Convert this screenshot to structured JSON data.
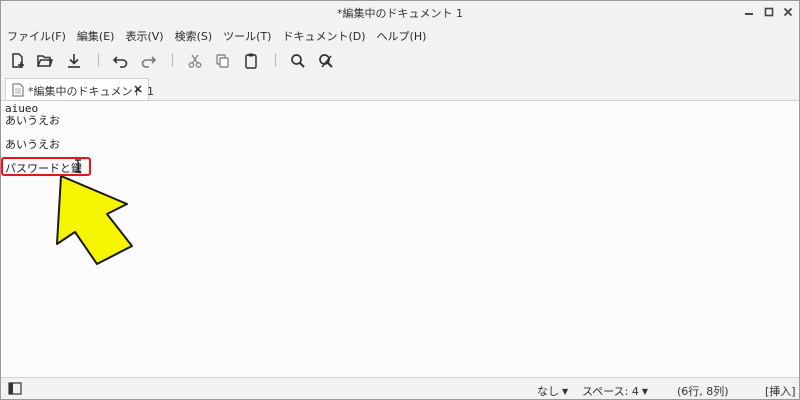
{
  "window": {
    "title": "*編集中のドキュメント 1"
  },
  "menu": {
    "items": [
      "ファイル(F)",
      "編集(E)",
      "表示(V)",
      "検索(S)",
      "ツール(T)",
      "ドキュメント(D)",
      "ヘルプ(H)"
    ]
  },
  "toolbar": {
    "icons": [
      "new-document-icon",
      "open-folder-icon",
      "save-download-icon",
      "undo-icon",
      "redo-icon",
      "cut-icon",
      "copy-icon",
      "paste-icon",
      "search-icon",
      "find-replace-icon"
    ]
  },
  "tab": {
    "label": "*編集中のドキュメント 1"
  },
  "editor": {
    "lines": [
      "aiueo",
      "あいうえお",
      "",
      "あいうえお",
      "",
      "パスワードと鍵"
    ]
  },
  "annotation": {
    "highlight_color": "#e8131b",
    "arrow_color": "#f5f500",
    "arrow_outline": "#1a1a1a"
  },
  "statusbar": {
    "language": "なし",
    "spaces": "スペース: 4",
    "position": "(6行, 8列)",
    "mode": "[挿入]"
  }
}
